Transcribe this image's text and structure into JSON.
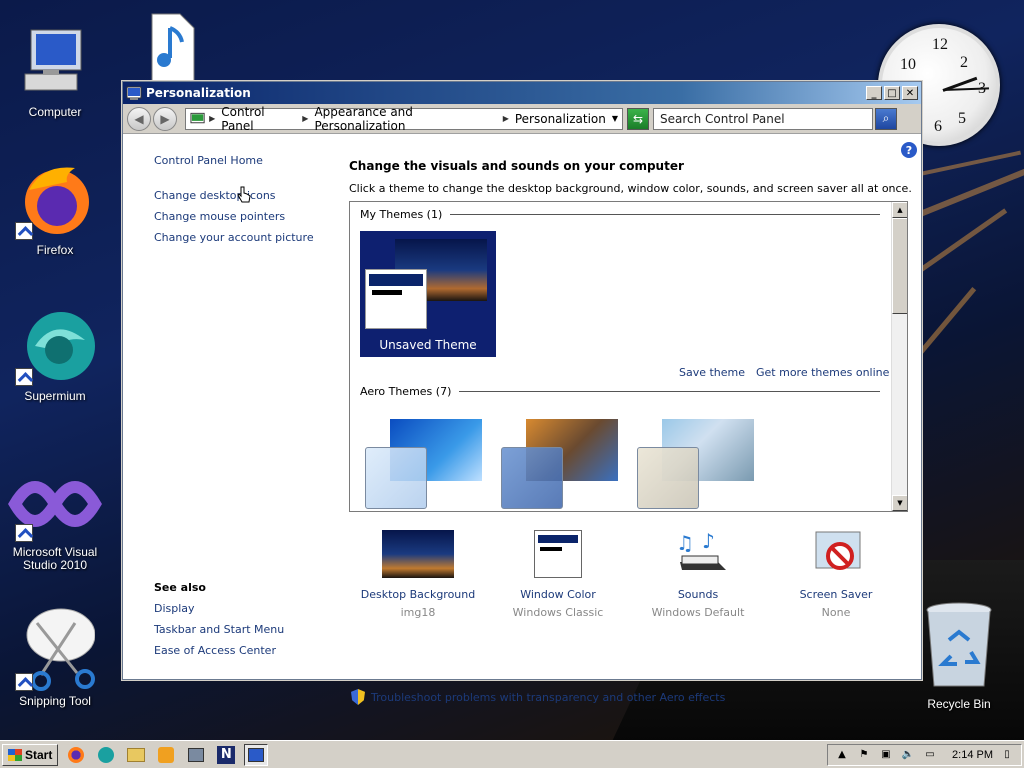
{
  "desktop": {
    "icons": [
      {
        "label": "Computer"
      },
      {
        "label": "Firefox"
      },
      {
        "label": "Supermium"
      },
      {
        "label": "Microsoft Visual Studio 2010"
      },
      {
        "label": "Snipping Tool"
      },
      {
        "label": "Recycle Bin"
      }
    ]
  },
  "window": {
    "title": "Personalization",
    "breadcrumbs": [
      "Control Panel",
      "Appearance and Personalization",
      "Personalization"
    ],
    "search_placeholder": "Search Control Panel"
  },
  "left_nav": {
    "links": [
      "Control Panel Home",
      "Change desktop icons",
      "Change mouse pointers",
      "Change your account picture"
    ],
    "see_also_heading": "See also",
    "see_also": [
      "Display",
      "Taskbar and Start Menu",
      "Ease of Access Center"
    ]
  },
  "main": {
    "heading": "Change the visuals and sounds on your computer",
    "subtext": "Click a theme to change the desktop background, window color, sounds, and screen saver all at once.",
    "my_themes_label": "My Themes (1)",
    "unsaved_theme": "Unsaved Theme",
    "save_theme": "Save theme",
    "get_more_themes": "Get more themes online",
    "aero_themes_label": "Aero Themes (7)",
    "bottom_items": [
      {
        "name": "Desktop Background",
        "value": "img18"
      },
      {
        "name": "Window Color",
        "value": "Windows Classic"
      },
      {
        "name": "Sounds",
        "value": "Windows Default"
      },
      {
        "name": "Screen Saver",
        "value": "None"
      }
    ],
    "troubleshoot": "Troubleshoot problems with transparency and other Aero effects"
  },
  "taskbar": {
    "start_label": "Start",
    "time": "2:14 PM"
  },
  "colors": {
    "link": "#1c3a7a",
    "titlebar": "#0a246a",
    "theme_selected": "#0e2070"
  }
}
